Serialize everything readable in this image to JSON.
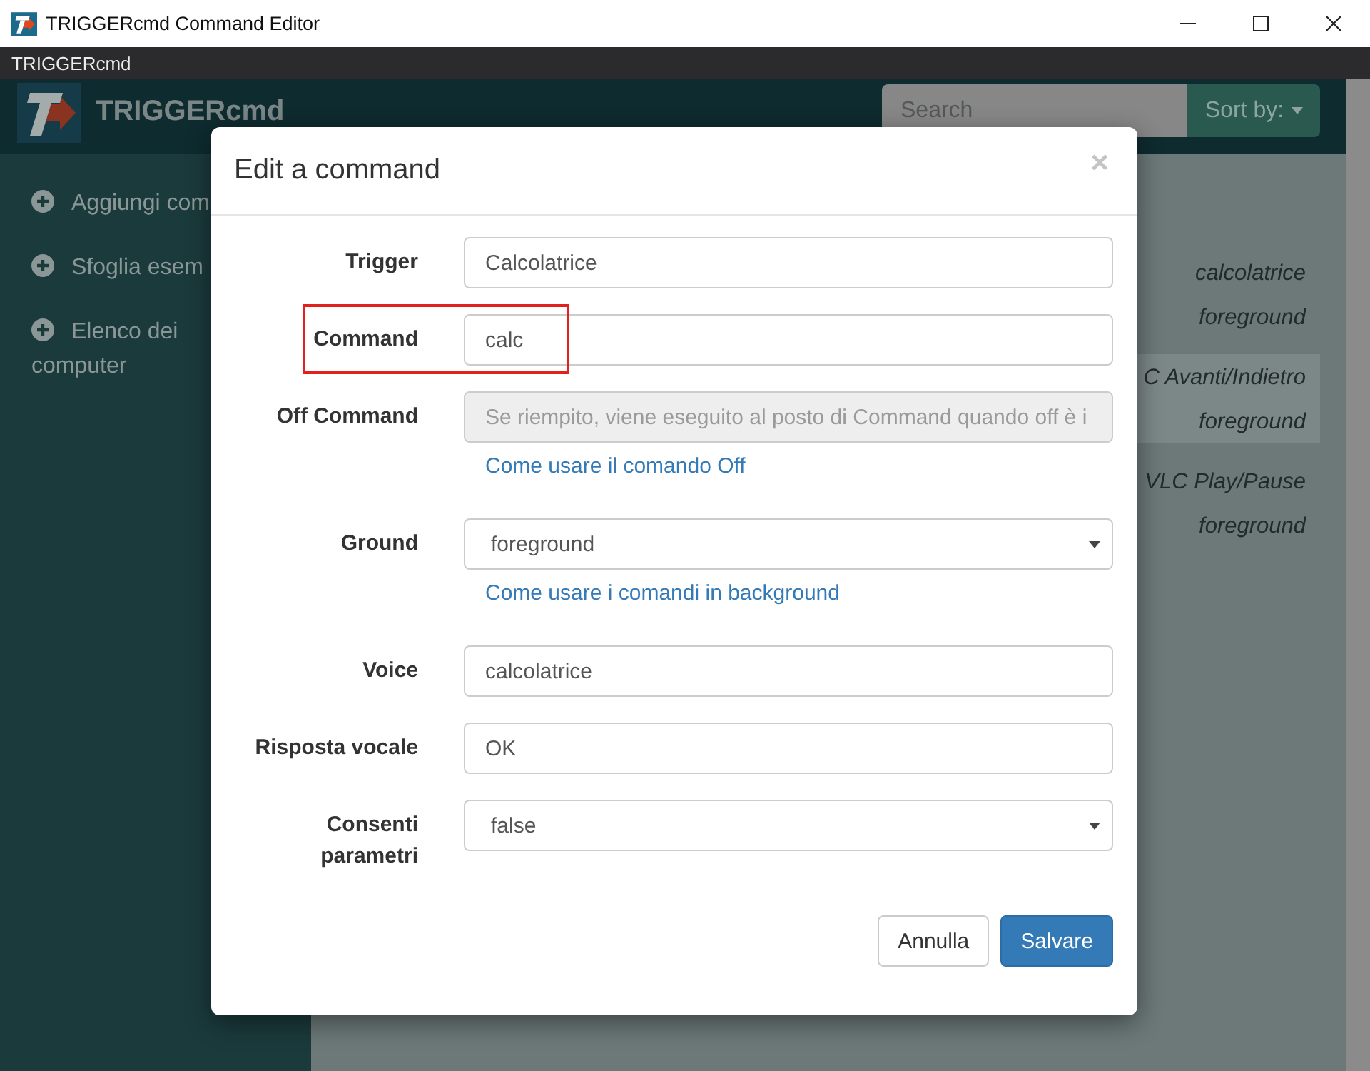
{
  "window": {
    "title": "TRIGGERcmd Command Editor"
  },
  "menu_bar": {
    "title": "TRIGGERcmd"
  },
  "header": {
    "brand": "TRIGGERcmd",
    "search": {
      "placeholder": "Search"
    },
    "sort_button": {
      "label": "Sort by:"
    }
  },
  "sidebar": {
    "items": [
      {
        "label": "Aggiungi com"
      },
      {
        "label": "Sfoglia esem"
      },
      {
        "label": "Elenco dei computer"
      }
    ]
  },
  "command_list": {
    "rows": [
      {
        "voice": "calcolatrice",
        "ground": "foreground",
        "selected": false
      },
      {
        "voice": "C Avanti/Indietro",
        "ground": "foreground",
        "selected": true
      },
      {
        "voice": "VLC Play/Pause",
        "ground": "foreground",
        "selected": false
      }
    ]
  },
  "dialog": {
    "title": "Edit a command",
    "close_label": "×",
    "fields": [
      {
        "label": "Trigger",
        "kind": "text",
        "value": "Calcolatrice",
        "highlighted": false
      },
      {
        "label": "Command",
        "kind": "text",
        "value": "calc",
        "highlighted": true
      },
      {
        "label": "Off Command",
        "kind": "disabled",
        "placeholder": "Se riempito, viene eseguito al posto di Command quando off è i",
        "help_link": "Come usare il comando Off",
        "highlighted": false
      },
      {
        "label": "Ground",
        "kind": "select",
        "value": "foreground",
        "help_link": "Come usare i comandi in background",
        "highlighted": false
      },
      {
        "label": "Voice",
        "kind": "text",
        "value": "calcolatrice",
        "highlighted": false
      },
      {
        "label": "Risposta vocale",
        "kind": "text",
        "value": "OK",
        "highlighted": false
      },
      {
        "label": "Consenti parametri",
        "kind": "select",
        "value": "false",
        "highlighted": false
      }
    ],
    "buttons": [
      {
        "label": "Annulla",
        "kind": "default"
      },
      {
        "label": "Salvare",
        "kind": "primary"
      }
    ]
  }
}
